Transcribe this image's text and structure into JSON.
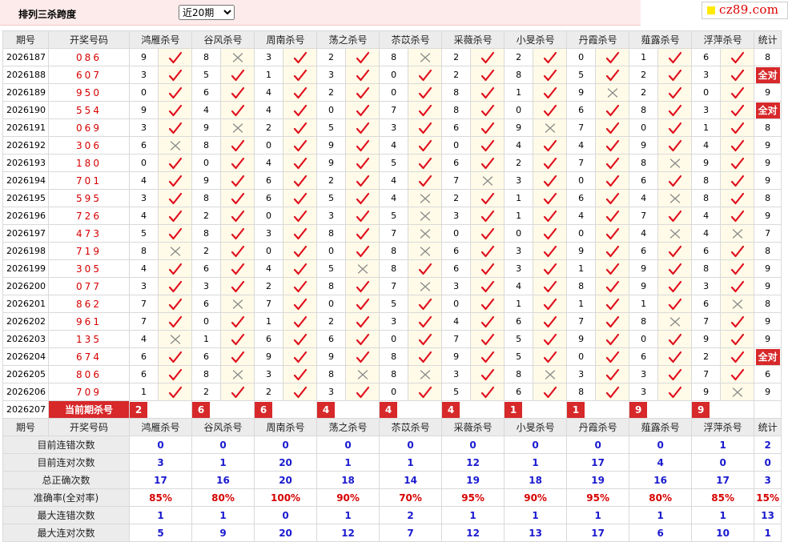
{
  "header": {
    "title": "排列三杀跨度",
    "period_options": [
      "近20期"
    ],
    "period_selected": "近20期"
  },
  "logo": {
    "text": "cz89.com"
  },
  "columns": {
    "issue": "期号",
    "draw": "开奖号码",
    "experts": [
      "鸿雁杀号",
      "谷风杀号",
      "周南杀号",
      "荡之杀号",
      "苶苡杀号",
      "采薇杀号",
      "小旻杀号",
      "丹霞杀号",
      "薤露杀号",
      "浮萍杀号"
    ],
    "stat": "统计"
  },
  "rows": [
    {
      "issue": "2026187",
      "draw": "086",
      "kills": [
        9,
        8,
        3,
        2,
        8,
        2,
        2,
        0,
        1,
        6
      ],
      "ok": [
        1,
        0,
        1,
        1,
        0,
        1,
        1,
        1,
        1,
        1
      ],
      "stat": "8"
    },
    {
      "issue": "2026188",
      "draw": "607",
      "kills": [
        3,
        5,
        1,
        3,
        0,
        2,
        8,
        5,
        2,
        3
      ],
      "ok": [
        1,
        1,
        1,
        1,
        1,
        1,
        1,
        1,
        1,
        1
      ],
      "stat": "全对"
    },
    {
      "issue": "2026189",
      "draw": "950",
      "kills": [
        0,
        6,
        4,
        2,
        0,
        8,
        1,
        9,
        2,
        0
      ],
      "ok": [
        1,
        1,
        1,
        1,
        1,
        1,
        1,
        0,
        1,
        1
      ],
      "stat": "9"
    },
    {
      "issue": "2026190",
      "draw": "554",
      "kills": [
        9,
        4,
        4,
        0,
        7,
        8,
        0,
        6,
        8,
        3
      ],
      "ok": [
        1,
        1,
        1,
        1,
        1,
        1,
        1,
        1,
        1,
        1
      ],
      "stat": "全对"
    },
    {
      "issue": "2026191",
      "draw": "069",
      "kills": [
        3,
        9,
        2,
        5,
        3,
        6,
        9,
        7,
        0,
        1
      ],
      "ok": [
        1,
        0,
        1,
        1,
        1,
        1,
        0,
        1,
        1,
        1
      ],
      "stat": "8"
    },
    {
      "issue": "2026192",
      "draw": "306",
      "kills": [
        6,
        8,
        0,
        9,
        4,
        0,
        4,
        4,
        9,
        4
      ],
      "ok": [
        0,
        1,
        1,
        1,
        1,
        1,
        1,
        1,
        1,
        1
      ],
      "stat": "9"
    },
    {
      "issue": "2026193",
      "draw": "180",
      "kills": [
        0,
        0,
        4,
        9,
        5,
        6,
        2,
        7,
        8,
        9
      ],
      "ok": [
        1,
        1,
        1,
        1,
        1,
        1,
        1,
        1,
        0,
        1
      ],
      "stat": "9"
    },
    {
      "issue": "2026194",
      "draw": "701",
      "kills": [
        4,
        9,
        6,
        2,
        4,
        7,
        3,
        0,
        6,
        8
      ],
      "ok": [
        1,
        1,
        1,
        1,
        1,
        0,
        1,
        1,
        1,
        1
      ],
      "stat": "9"
    },
    {
      "issue": "2026195",
      "draw": "595",
      "kills": [
        3,
        8,
        6,
        5,
        4,
        2,
        1,
        6,
        4,
        8
      ],
      "ok": [
        1,
        1,
        1,
        1,
        0,
        1,
        1,
        1,
        0,
        1
      ],
      "stat": "8"
    },
    {
      "issue": "2026196",
      "draw": "726",
      "kills": [
        4,
        2,
        0,
        3,
        5,
        3,
        1,
        4,
        7,
        4
      ],
      "ok": [
        1,
        1,
        1,
        1,
        0,
        1,
        1,
        1,
        1,
        1
      ],
      "stat": "9"
    },
    {
      "issue": "2026197",
      "draw": "473",
      "kills": [
        5,
        8,
        3,
        8,
        7,
        0,
        0,
        0,
        4,
        4
      ],
      "ok": [
        1,
        1,
        1,
        1,
        0,
        1,
        1,
        1,
        0,
        0
      ],
      "stat": "7"
    },
    {
      "issue": "2026198",
      "draw": "719",
      "kills": [
        8,
        2,
        0,
        0,
        8,
        6,
        3,
        9,
        6,
        6
      ],
      "ok": [
        0,
        1,
        1,
        1,
        0,
        1,
        1,
        1,
        1,
        1
      ],
      "stat": "8"
    },
    {
      "issue": "2026199",
      "draw": "305",
      "kills": [
        4,
        6,
        4,
        5,
        8,
        6,
        3,
        1,
        9,
        8
      ],
      "ok": [
        1,
        1,
        1,
        0,
        1,
        1,
        1,
        1,
        1,
        1
      ],
      "stat": "9"
    },
    {
      "issue": "2026200",
      "draw": "077",
      "kills": [
        3,
        3,
        2,
        8,
        7,
        3,
        4,
        8,
        9,
        3
      ],
      "ok": [
        1,
        1,
        1,
        1,
        0,
        1,
        1,
        1,
        1,
        1
      ],
      "stat": "9"
    },
    {
      "issue": "2026201",
      "draw": "862",
      "kills": [
        7,
        6,
        7,
        0,
        5,
        0,
        1,
        1,
        1,
        6
      ],
      "ok": [
        1,
        0,
        1,
        1,
        1,
        1,
        1,
        1,
        1,
        0
      ],
      "stat": "8"
    },
    {
      "issue": "2026202",
      "draw": "961",
      "kills": [
        7,
        0,
        1,
        2,
        3,
        4,
        6,
        7,
        8,
        7
      ],
      "ok": [
        1,
        1,
        1,
        1,
        1,
        1,
        1,
        1,
        0,
        1
      ],
      "stat": "9"
    },
    {
      "issue": "2026203",
      "draw": "135",
      "kills": [
        4,
        1,
        6,
        6,
        0,
        7,
        5,
        9,
        0,
        9
      ],
      "ok": [
        0,
        1,
        1,
        1,
        1,
        1,
        1,
        1,
        1,
        1
      ],
      "stat": "9"
    },
    {
      "issue": "2026204",
      "draw": "674",
      "kills": [
        6,
        6,
        9,
        9,
        8,
        9,
        5,
        0,
        6,
        2
      ],
      "ok": [
        1,
        1,
        1,
        1,
        1,
        1,
        1,
        1,
        1,
        1
      ],
      "stat": "全对"
    },
    {
      "issue": "2026205",
      "draw": "806",
      "kills": [
        6,
        8,
        3,
        8,
        8,
        3,
        8,
        3,
        3,
        7
      ],
      "ok": [
        1,
        0,
        1,
        0,
        0,
        1,
        0,
        1,
        1,
        1
      ],
      "stat": "6"
    },
    {
      "issue": "2026206",
      "draw": "709",
      "kills": [
        1,
        2,
        2,
        3,
        0,
        5,
        6,
        8,
        3,
        9
      ],
      "ok": [
        1,
        1,
        1,
        1,
        1,
        1,
        1,
        1,
        1,
        0
      ],
      "stat": "9"
    }
  ],
  "current": {
    "issue": "2026207",
    "label": "当前期杀号",
    "kills": [
      2,
      6,
      6,
      4,
      4,
      4,
      1,
      1,
      9,
      9
    ]
  },
  "stats": [
    {
      "label": "目前连错次数",
      "values": [
        "0",
        "0",
        "0",
        "0",
        "0",
        "0",
        "0",
        "0",
        "0",
        "1"
      ],
      "stat": "2",
      "accent": false
    },
    {
      "label": "目前连对次数",
      "values": [
        "3",
        "1",
        "20",
        "1",
        "1",
        "12",
        "1",
        "17",
        "4",
        "0"
      ],
      "stat": "0",
      "accent": false
    },
    {
      "label": "总正确次数",
      "values": [
        "17",
        "16",
        "20",
        "18",
        "14",
        "19",
        "18",
        "19",
        "16",
        "17"
      ],
      "stat": "3",
      "accent": false
    },
    {
      "label": "准确率(全对率)",
      "values": [
        "85%",
        "80%",
        "100%",
        "90%",
        "70%",
        "95%",
        "90%",
        "95%",
        "80%",
        "85%"
      ],
      "stat": "15%",
      "accent": true
    },
    {
      "label": "最大连错次数",
      "values": [
        "1",
        "1",
        "0",
        "1",
        "2",
        "1",
        "1",
        "1",
        "1",
        "1"
      ],
      "stat": "13",
      "accent": false
    },
    {
      "label": "最大连对次数",
      "values": [
        "5",
        "9",
        "20",
        "12",
        "7",
        "12",
        "13",
        "17",
        "6",
        "10"
      ],
      "stat": "1",
      "accent": false
    }
  ],
  "colors": {
    "accent_red": "#d7282a",
    "stat_blue": "#1a1ad0",
    "header_bg": "#ececec",
    "mark_bg": "#fffbe8",
    "top_bg": "#fdeaea"
  },
  "icons": {
    "correct": "check-icon",
    "wrong": "cross-icon"
  }
}
